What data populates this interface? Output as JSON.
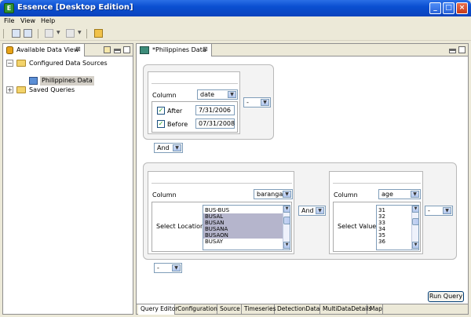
{
  "window": {
    "title": "Essence [Desktop Edition]",
    "app_icon_glyph": "E",
    "controls": {
      "minimize": "_",
      "maximize": "□",
      "close": "×"
    }
  },
  "menu": [
    "File",
    "View",
    "Help"
  ],
  "toolbar": {
    "icons": [
      "save-icon",
      "save-all-icon",
      "back-icon",
      "forward-icon",
      "undo-icon"
    ]
  },
  "left_view": {
    "tab_title": "Available Data View",
    "close_glyph": "⊠",
    "tree": {
      "collapse_glyph": "−",
      "expand_glyph": "+",
      "configured": "Configured Data Sources",
      "source": "Philippines Data",
      "saved": "Saved Queries"
    }
  },
  "editor": {
    "tab_title": "*Philippines Data",
    "close_glyph": "⊠",
    "dropdown_glyph": "▼",
    "date_card": {
      "column_label": "Column",
      "column_value": "date",
      "after_label": "After",
      "after_value": "7/31/2006",
      "after_checked": "✓",
      "before_label": "Before",
      "before_value": "07/31/2008",
      "before_checked": "✓",
      "op_value": "-"
    },
    "connector1": "And",
    "location_card": {
      "column_label": "Column",
      "column_value": "barangay",
      "select_label": "Select Locations",
      "items": [
        {
          "text": "BUS-BUS",
          "selected": false
        },
        {
          "text": "BUSAL",
          "selected": true
        },
        {
          "text": "BUSAN",
          "selected": true
        },
        {
          "text": "BUSANA",
          "selected": true
        },
        {
          "text": "BUSAON",
          "selected": true
        },
        {
          "text": "BUSAY",
          "selected": false
        }
      ]
    },
    "connector2": "And",
    "age_card": {
      "column_label": "Column",
      "column_value": "age",
      "select_label": "Select Values",
      "items": [
        {
          "text": "31",
          "selected": false
        },
        {
          "text": "32",
          "selected": false
        },
        {
          "text": "33",
          "selected": false
        },
        {
          "text": "34",
          "selected": false
        },
        {
          "text": "35",
          "selected": false
        },
        {
          "text": "36",
          "selected": false
        }
      ],
      "op_value": "-"
    },
    "bottom_op": "-",
    "run_button": "Run Query",
    "tabs": [
      {
        "label": "Query Editor",
        "active": true
      },
      {
        "label": "Configuration",
        "active": false
      },
      {
        "label": "Source",
        "active": false
      },
      {
        "label": "Timeseries",
        "active": false
      },
      {
        "label": "DetectionData",
        "active": false
      },
      {
        "label": "MultiDataDetails",
        "active": false
      },
      {
        "label": "Map",
        "active": false
      }
    ]
  }
}
